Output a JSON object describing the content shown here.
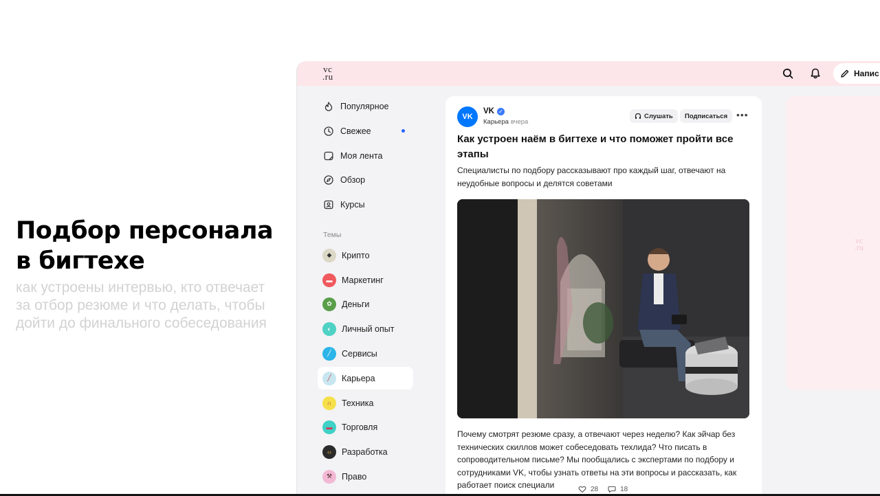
{
  "promo": {
    "title_line1": "Подбор персонала",
    "title_line2": "в бигтехе",
    "sub_line1": "как устроены интервью, кто отвечает",
    "sub_line2": "за отбор резюме и что делать, чтобы",
    "sub_line3": "дойти до финального собеседования"
  },
  "header": {
    "logo_top": "vc",
    "logo_bottom": ".ru",
    "write_label": "Напис"
  },
  "sidebar": {
    "items": [
      {
        "label": "Популярное",
        "icon": "flame-icon"
      },
      {
        "label": "Свежее",
        "icon": "clock-icon"
      },
      {
        "label": "Моя лента",
        "icon": "feed-icon"
      },
      {
        "label": "Обзор",
        "icon": "compass-icon"
      },
      {
        "label": "Курсы",
        "icon": "courses-icon"
      }
    ],
    "topics_label": "Темы",
    "topics": [
      {
        "label": "Крипто",
        "color": "#d9d5c5"
      },
      {
        "label": "Маркетинг",
        "color": "#f0595d"
      },
      {
        "label": "Деньги",
        "color": "#5a9e4a"
      },
      {
        "label": "Личный опыт",
        "color": "#4fd1c5"
      },
      {
        "label": "Сервисы",
        "color": "#2bb5e8"
      },
      {
        "label": "Карьера",
        "color": "#c7e6f0"
      },
      {
        "label": "Техника",
        "color": "#f5e04a"
      },
      {
        "label": "Торговля",
        "color": "#3fd0c6"
      },
      {
        "label": "Разработка",
        "color": "#2b2b2b"
      },
      {
        "label": "Право",
        "color": "#f2b8d4"
      }
    ]
  },
  "post": {
    "avatar_text": "VK",
    "author": "VK",
    "category": "Карьера",
    "time": "вчера",
    "listen_label": "Слушать",
    "subscribe_label": "Подписаться",
    "title": "Как устроен наём в бигтехе и что поможет пройти все этапы",
    "lead": "Специалисты по подбору рассказывают про каждый шаг, отвечают на неудобные вопросы и делятся советами",
    "body": "Почему смотрят резюме сразу, а отвечают через неделю? Как эйчар без технических скиллов может собеседовать техлида? Что писать в сопроводительном письме? Мы пообщались с экспертами по подбору и сотрудниками VK, чтобы узнать ответы на эти вопросы и рассказать, как работает поиск специали",
    "likes": "28",
    "comments": "18"
  },
  "colors": {
    "header_bg": "#fde6ea",
    "accent_blue": "#0077ff",
    "fresh_dot": "#2962ff"
  }
}
